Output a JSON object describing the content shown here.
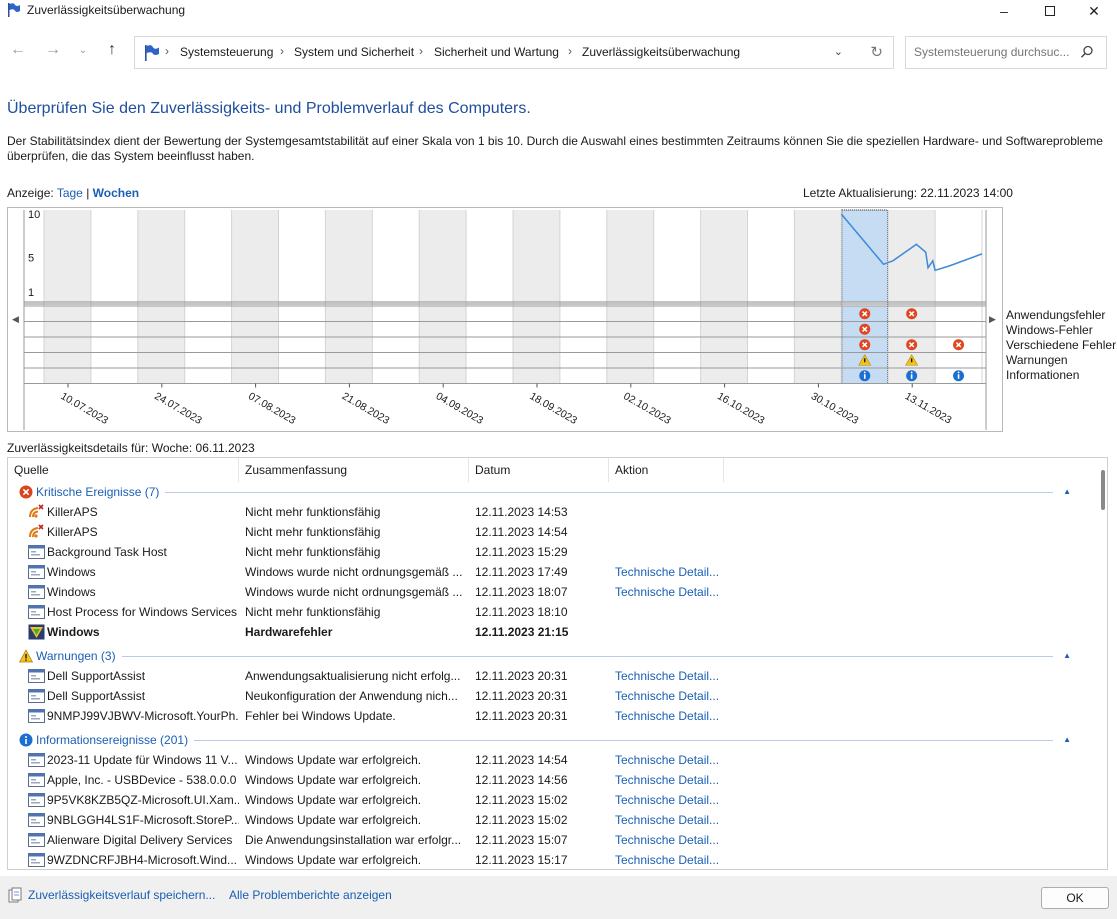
{
  "window": {
    "title": "Zuverlässigkeitsüberwachung"
  },
  "address": {
    "crumbs": [
      "Systemsteuerung",
      "System und Sicherheit",
      "Sicherheit und Wartung",
      "Zuverlässigkeitsüberwachung"
    ],
    "search_placeholder": "Systemsteuerung durchsuc..."
  },
  "heading": "Überprüfen Sie den Zuverlässigkeits- und Problemverlauf des Computers.",
  "description": "Der Stabilitätsindex dient der Bewertung der Systemgesamtstabilität auf einer Skala von 1 bis 10. Durch die Auswahl eines bestimmten Zeitraums können Sie die speziellen Hardware- und Softwareprobleme überprüfen, die das System beeinflusst haben.",
  "view": {
    "label": "Anzeige:",
    "days": "Tage",
    "sep": "|",
    "weeks": "Wochen"
  },
  "last_update": "Letzte Aktualisierung: 22.11.2023 14:00",
  "legend": [
    "Anwendungsfehler",
    "Windows-Fehler",
    "Verschiedene Fehler",
    "Warnungen",
    "Informationen"
  ],
  "chart_data": {
    "type": "line",
    "yticks": [
      "10",
      "5",
      "1"
    ],
    "ylim": [
      1,
      10
    ],
    "x_labels": [
      "10.07.2023",
      "24.07.2023",
      "07.08.2023",
      "21.08.2023",
      "04.09.2023",
      "18.09.2023",
      "02.10.2023",
      "16.10.2023",
      "30.10.2023",
      "13.11.2023"
    ],
    "num_columns": 20,
    "selected_column": 17,
    "stability_series": [
      {
        "col": 17.0,
        "value": 10
      },
      {
        "col": 17.9,
        "value": 4.2
      },
      {
        "col": 18.1,
        "value": 4.6
      },
      {
        "col": 18.6,
        "value": 6.5
      },
      {
        "col": 18.8,
        "value": 5.6
      },
      {
        "col": 18.85,
        "value": 3.8
      },
      {
        "col": 18.95,
        "value": 4.6
      },
      {
        "col": 19.0,
        "value": 3.5
      },
      {
        "col": 19.3,
        "value": 4.0
      },
      {
        "col": 20.0,
        "value": 5.4
      }
    ],
    "event_markers": [
      {
        "col": 17,
        "row": 0,
        "kind": "error"
      },
      {
        "col": 17,
        "row": 1,
        "kind": "error"
      },
      {
        "col": 17,
        "row": 2,
        "kind": "error"
      },
      {
        "col": 17,
        "row": 3,
        "kind": "warning"
      },
      {
        "col": 17,
        "row": 4,
        "kind": "info"
      },
      {
        "col": 18,
        "row": 0,
        "kind": "error"
      },
      {
        "col": 18,
        "row": 2,
        "kind": "error"
      },
      {
        "col": 18,
        "row": 3,
        "kind": "warning"
      },
      {
        "col": 18,
        "row": 4,
        "kind": "info"
      },
      {
        "col": 19,
        "row": 2,
        "kind": "error"
      },
      {
        "col": 19,
        "row": 4,
        "kind": "info"
      }
    ]
  },
  "details_for": "Zuverlässigkeitsdetails für: Woche: 06.11.2023",
  "columns": {
    "source": "Quelle",
    "summary": "Zusammenfassung",
    "date": "Datum",
    "action": "Aktion"
  },
  "groups": [
    {
      "kind": "error",
      "label": "Kritische Ereignisse (7)",
      "rows": [
        {
          "icon": "killer",
          "source": "KillerAPS",
          "summary": "Nicht mehr funktionsfähig",
          "date": "12.11.2023 14:53",
          "action": ""
        },
        {
          "icon": "killer",
          "source": "KillerAPS",
          "summary": "Nicht mehr funktionsfähig",
          "date": "12.11.2023 14:54",
          "action": ""
        },
        {
          "icon": "app",
          "source": "Background Task Host",
          "summary": "Nicht mehr funktionsfähig",
          "date": "12.11.2023 15:29",
          "action": ""
        },
        {
          "icon": "app",
          "source": "Windows",
          "summary": "Windows wurde nicht ordnungsgemäß ...",
          "date": "12.11.2023 17:49",
          "action": "Technische Detail..."
        },
        {
          "icon": "app",
          "source": "Windows",
          "summary": "Windows wurde nicht ordnungsgemäß ...",
          "date": "12.11.2023 18:07",
          "action": "Technische Detail..."
        },
        {
          "icon": "app",
          "source": "Host Process for Windows Services",
          "summary": "Nicht mehr funktionsfähig",
          "date": "12.11.2023 18:10",
          "action": ""
        },
        {
          "icon": "hw",
          "source": "Windows",
          "summary": "Hardwarefehler",
          "date": "12.11.2023 21:15",
          "action": "",
          "bold": true
        }
      ]
    },
    {
      "kind": "warning",
      "label": "Warnungen (3)",
      "rows": [
        {
          "icon": "app",
          "source": "Dell SupportAssist",
          "summary": "Anwendungsaktualisierung nicht erfolg...",
          "date": "12.11.2023 20:31",
          "action": "Technische Detail..."
        },
        {
          "icon": "app",
          "source": "Dell SupportAssist",
          "summary": "Neukonfiguration der Anwendung nich...",
          "date": "12.11.2023 20:31",
          "action": "Technische Detail..."
        },
        {
          "icon": "app",
          "source": "9NMPJ99VJBWV-Microsoft.YourPh...",
          "summary": "Fehler bei Windows Update.",
          "date": "12.11.2023 20:31",
          "action": "Technische Detail..."
        }
      ]
    },
    {
      "kind": "info",
      "label": "Informationsereignisse (201)",
      "rows": [
        {
          "icon": "app",
          "source": "2023-11 Update für Windows 11 V...",
          "summary": "Windows Update war erfolgreich.",
          "date": "12.11.2023 14:54",
          "action": "Technische Detail..."
        },
        {
          "icon": "app",
          "source": "Apple, Inc. - USBDevice - 538.0.0.0",
          "summary": "Windows Update war erfolgreich.",
          "date": "12.11.2023 14:56",
          "action": "Technische Detail..."
        },
        {
          "icon": "app",
          "source": "9P5VK8KZB5QZ-Microsoft.UI.Xam...",
          "summary": "Windows Update war erfolgreich.",
          "date": "12.11.2023 15:02",
          "action": "Technische Detail..."
        },
        {
          "icon": "app",
          "source": "9NBLGGH4LS1F-Microsoft.StoreP...",
          "summary": "Windows Update war erfolgreich.",
          "date": "12.11.2023 15:02",
          "action": "Technische Detail..."
        },
        {
          "icon": "app",
          "source": "Alienware Digital Delivery Services",
          "summary": "Die Anwendungsinstallation war erfolgr...",
          "date": "12.11.2023 15:07",
          "action": "Technische Detail..."
        },
        {
          "icon": "app",
          "source": "9WZDNCRFJBH4-Microsoft.Wind...",
          "summary": "Windows Update war erfolgreich.",
          "date": "12.11.2023 15:17",
          "action": "Technische Detail..."
        }
      ]
    }
  ],
  "footer": {
    "save_link": "Zuverlässigkeitsverlauf speichern...",
    "reports_link": "Alle Problemberichte anzeigen",
    "ok": "OK"
  }
}
